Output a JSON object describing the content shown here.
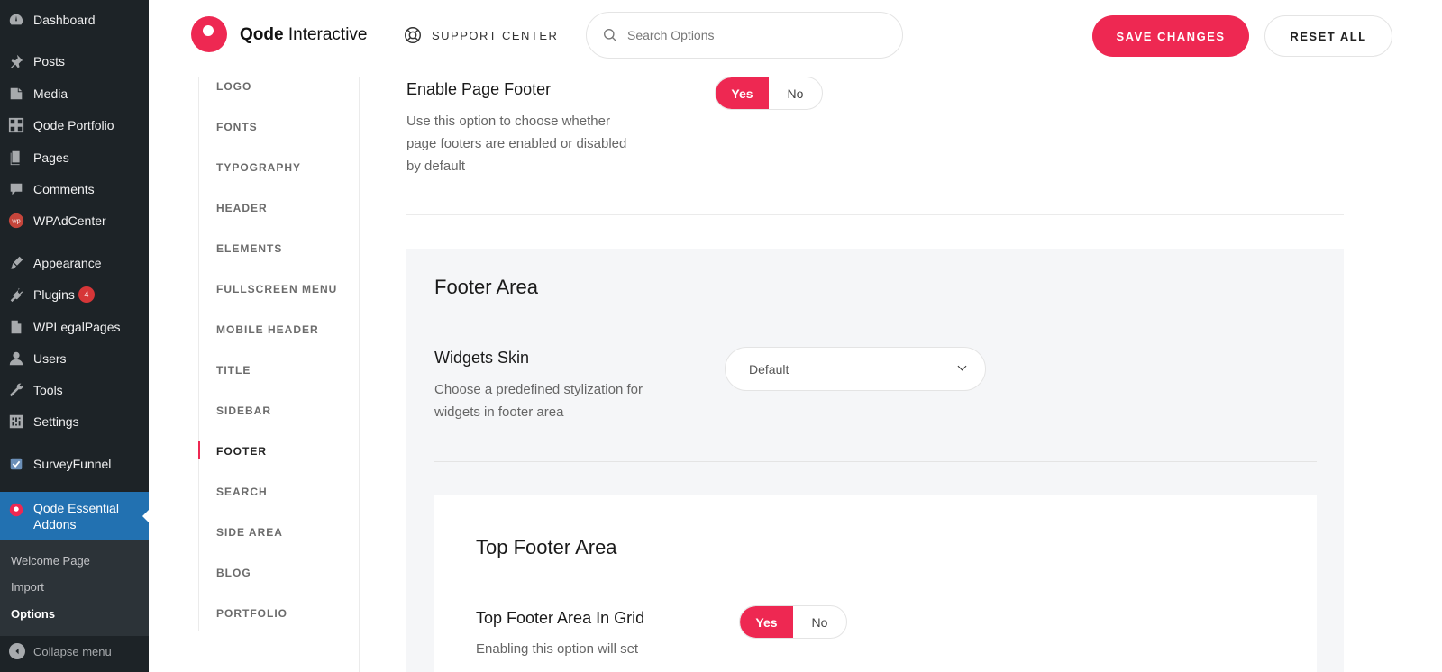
{
  "wp_sidebar": {
    "items": [
      {
        "label": "Dashboard",
        "icon": "dashboard-icon"
      },
      {
        "label": "Posts",
        "icon": "pin-icon"
      },
      {
        "label": "Media",
        "icon": "media-icon"
      },
      {
        "label": "Qode Portfolio",
        "icon": "grid-icon"
      },
      {
        "label": "Pages",
        "icon": "pages-icon"
      },
      {
        "label": "Comments",
        "icon": "comment-icon"
      },
      {
        "label": "WPAdCenter",
        "icon": "wp-badge-icon"
      },
      {
        "label": "Appearance",
        "icon": "brush-icon"
      },
      {
        "label": "Plugins",
        "icon": "plug-icon",
        "badge": "4"
      },
      {
        "label": "WPLegalPages",
        "icon": "document-icon"
      },
      {
        "label": "Users",
        "icon": "user-icon"
      },
      {
        "label": "Tools",
        "icon": "wrench-icon"
      },
      {
        "label": "Settings",
        "icon": "sliders-icon"
      },
      {
        "label": "SurveyFunnel",
        "icon": "survey-icon"
      }
    ],
    "active": {
      "label": "Qode Essential Addons",
      "icon": "qode-icon"
    },
    "submenu": [
      {
        "label": "Welcome Page"
      },
      {
        "label": "Import"
      },
      {
        "label": "Options",
        "current": true
      }
    ],
    "collapse_label": "Collapse menu"
  },
  "header": {
    "logo_bold": "Qode",
    "logo_light": "Interactive",
    "support_label": "SUPPORT CENTER",
    "search_placeholder": "Search Options",
    "save_label": "SAVE CHANGES",
    "reset_label": "RESET ALL",
    "accent_color": "#ee2852"
  },
  "options_nav": {
    "items": [
      "LOGO",
      "FONTS",
      "TYPOGRAPHY",
      "HEADER",
      "ELEMENTS",
      "FULLSCREEN MENU",
      "MOBILE HEADER",
      "TITLE",
      "SIDEBAR",
      "FOOTER",
      "SEARCH",
      "SIDE AREA",
      "BLOG",
      "PORTFOLIO"
    ],
    "active": "FOOTER"
  },
  "main": {
    "enable_footer": {
      "title": "Enable Page Footer",
      "desc_lines": [
        "Use this option to choose whether",
        "page footers are enabled or disabled",
        "by default"
      ],
      "yes": "Yes",
      "no": "No",
      "selected": "Yes"
    },
    "footer_area": {
      "title": "Footer Area",
      "widgets_skin": {
        "title": "Widgets Skin",
        "desc_lines": [
          "Choose a predefined stylization for",
          "widgets in footer area"
        ],
        "value": "Default"
      }
    },
    "top_footer": {
      "title": "Top Footer Area",
      "in_grid": {
        "title": "Top Footer Area In Grid",
        "desc_lines": [
          "Enabling this option will set"
        ],
        "yes": "Yes",
        "no": "No",
        "selected": "Yes"
      }
    }
  }
}
